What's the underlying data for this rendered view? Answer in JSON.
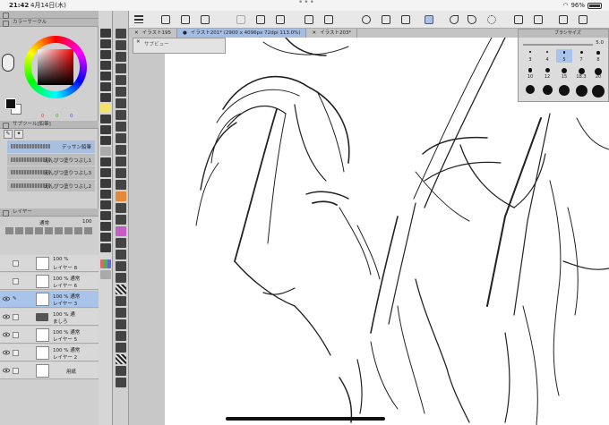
{
  "status_bar": {
    "time": "21:42",
    "date": "4月14日(木)",
    "battery": "96%"
  },
  "color_panel": {
    "title": "カラーサークル",
    "rgb": [
      "0",
      "0",
      "0"
    ]
  },
  "subtool_panel": {
    "title": "サブツール[鉛筆]",
    "items": [
      {
        "label": "デッサン鉛筆"
      },
      {
        "label": "えんぴつ塗りつぶし1"
      },
      {
        "label": "えんぴつ塗りつぶし3"
      },
      {
        "label": "えんぴつ塗りつぶし2"
      }
    ]
  },
  "layer_panel": {
    "title": "レイヤー",
    "blend_mode": "通常",
    "opacity": "100",
    "layers": [
      {
        "line1": "100 %",
        "line2": "レイヤー 8"
      },
      {
        "line1": "100 % 通常",
        "line2": "レイヤー 6"
      },
      {
        "line1": "100 % 通常",
        "line2": "レイヤー 3"
      },
      {
        "line1": "100 % 通",
        "line2": "ましろ"
      },
      {
        "line1": "100 % 通常",
        "line2": "レイヤー 5"
      },
      {
        "line1": "100 % 通常",
        "line2": "レイヤー 2"
      },
      {
        "line1": "",
        "line2": "用紙"
      }
    ]
  },
  "tabs": [
    {
      "label": "イラスト195"
    },
    {
      "label": "イラスト201* (2900 x 4096px 72dpi 113.0%)"
    },
    {
      "label": "イラスト203*"
    }
  ],
  "sub_view": {
    "title": "サブビュー"
  },
  "brush_size": {
    "title": "ブラシサイズ",
    "value": "5.0",
    "sizes": [
      "3",
      "4",
      "5",
      "7",
      "8",
      "10",
      "12",
      "15",
      "18.3",
      "20",
      "",
      "",
      "",
      "",
      ""
    ],
    "selected": "5"
  },
  "command_bar": {
    "icons": [
      "menu-icon",
      "new-icon",
      "save-icon",
      "share-icon",
      "cut-icon",
      "transform-icon",
      "move-icon",
      "flip-icon",
      "zoom-icon",
      "nav-icon",
      "settings-icon",
      "active-tool-icon",
      "undo-icon",
      "redo-icon",
      "loading-icon",
      "fill-icon",
      "pen-icon",
      "fullscreen-icon",
      "close-icon"
    ]
  }
}
